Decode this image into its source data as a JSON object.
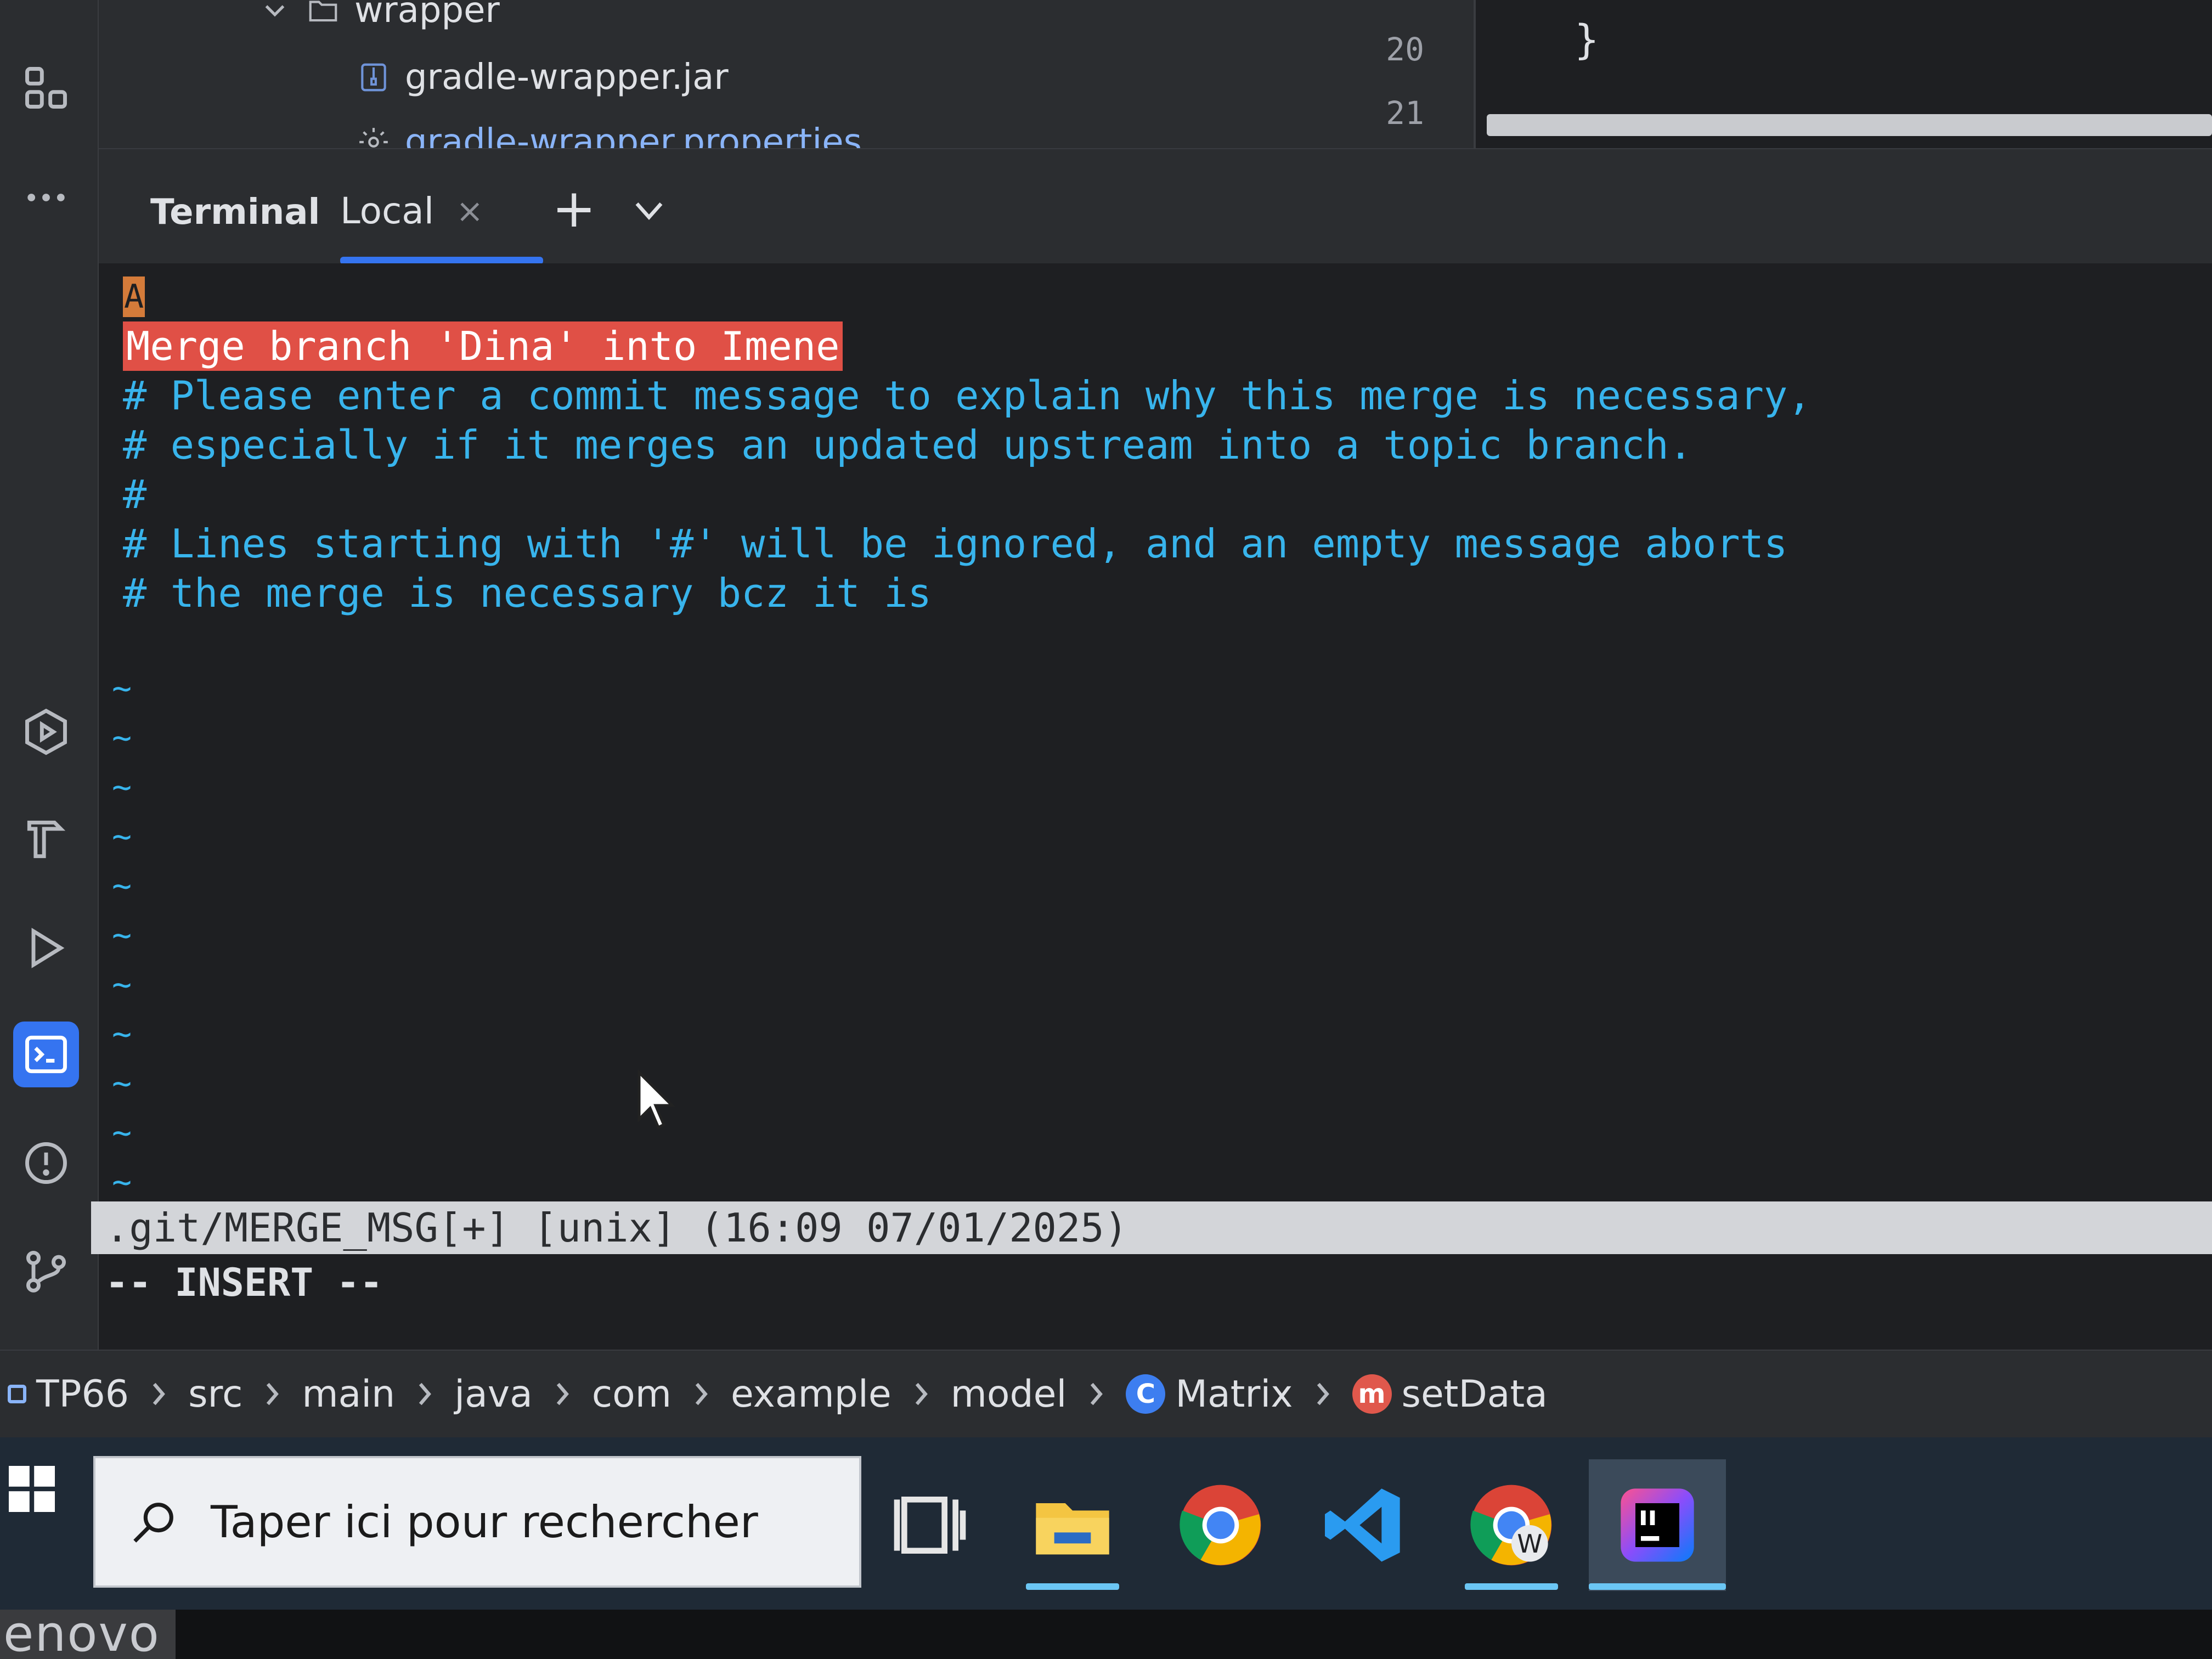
{
  "project_tree": {
    "folder": "wrapper",
    "files": [
      {
        "name": "gradle-wrapper.jar",
        "icon": "archive-icon"
      },
      {
        "name": "gradle-wrapper.properties",
        "icon": "settings-file-icon"
      }
    ]
  },
  "editor": {
    "line_numbers": [
      "20",
      "21"
    ],
    "code_line_20": "}"
  },
  "terminal_tabs": {
    "title": "Terminal",
    "local_tab": "Local",
    "close_glyph": "×",
    "new_tab_glyph": "+"
  },
  "terminal": {
    "cursor_char": "A",
    "highlighted_line": "Merge branch 'Dina' into Imene",
    "comment_lines": [
      "# Please enter a commit message to explain why this merge is necessary,",
      "# especially if it merges an updated upstream into a topic branch.",
      "#",
      "# Lines starting with '#' will be ignored, and an empty message aborts",
      "# the merge is necessary bcz it is"
    ],
    "tilde": "~",
    "status_line": ".git/MERGE_MSG[+] [unix] (16:09 07/01/2025)",
    "mode_line": "-- INSERT --"
  },
  "breadcrumb": {
    "items": [
      "TP66",
      "src",
      "main",
      "java",
      "com",
      "example",
      "model",
      "Matrix",
      "setData"
    ],
    "class_badge": "C",
    "method_badge": "m"
  },
  "taskbar": {
    "search_placeholder": "Taper ici pour rechercher"
  },
  "bezel": {
    "logo": "enovo"
  },
  "colors": {
    "accent": "#3574f0",
    "comment": "#38b4ec",
    "merge_highlight": "#e05046",
    "status_bar": "#d3d5d9",
    "taskbar": "#1f2a36"
  }
}
